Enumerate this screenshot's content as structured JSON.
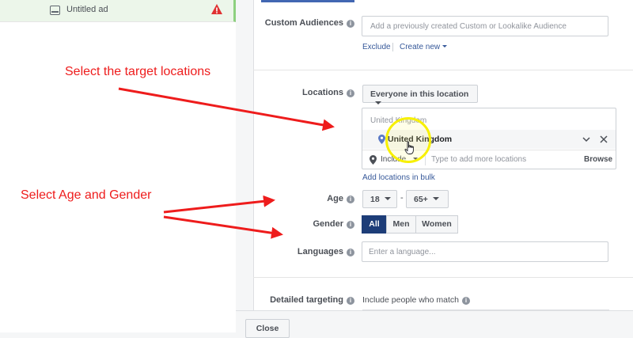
{
  "sidebar": {
    "ad_name": "Untitled ad",
    "icons": {
      "ad": "ad-icon",
      "warning": "warning-icon"
    }
  },
  "custom_audiences": {
    "label": "Custom Audiences",
    "placeholder": "Add a previously created Custom or Lookalike Audience",
    "exclude": "Exclude",
    "create_new": "Create new"
  },
  "locations": {
    "label": "Locations",
    "mode_dropdown": "Everyone in this location",
    "header": "United Kingdom",
    "selected": "United Kingdom",
    "include_label": "Include",
    "input_placeholder": "Type to add more locations",
    "browse": "Browse",
    "bulk_link": "Add locations in bulk"
  },
  "age": {
    "label": "Age",
    "min": "18",
    "separator": "-",
    "max": "65+"
  },
  "gender": {
    "label": "Gender",
    "options": [
      "All",
      "Men",
      "Women"
    ],
    "selected": "All"
  },
  "languages": {
    "label": "Languages",
    "placeholder": "Enter a language..."
  },
  "detailed_targeting": {
    "label": "Detailed targeting",
    "subtitle": "Include people who match"
  },
  "footer": {
    "close": "Close"
  },
  "annotations": {
    "locations_note": "Select the target locations",
    "age_gender_note": "Select Age and Gender"
  },
  "colors": {
    "annotation": "#ee1c1c",
    "active_segment": "#1d3d78",
    "link": "#365899",
    "cursor_highlight": "#f7f000"
  }
}
